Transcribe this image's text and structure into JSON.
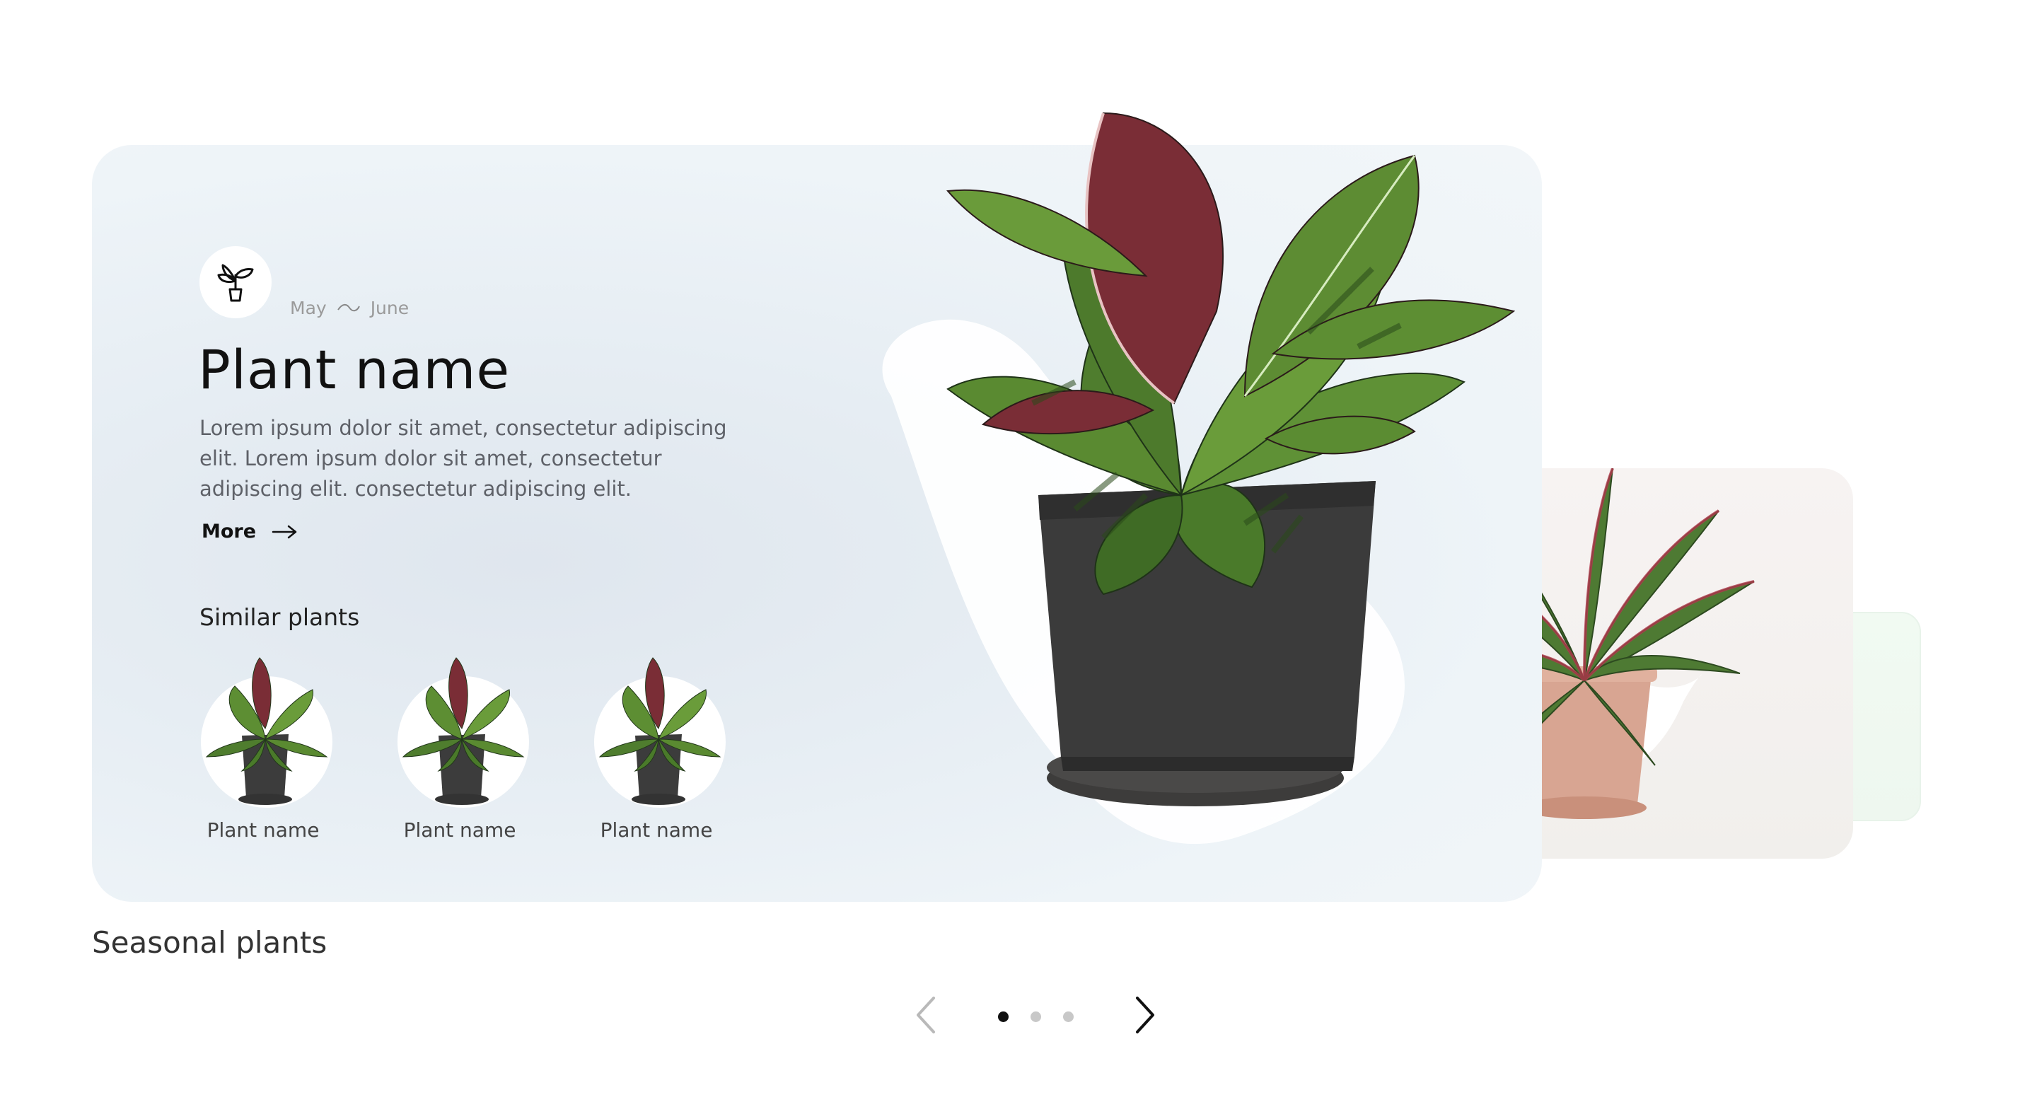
{
  "card": {
    "season_from": "May",
    "season_to": "June",
    "title": "Plant name",
    "description": "Lorem ipsum dolor sit amet, consectetur adipiscing elit. Lorem ipsum dolor sit amet, consectetur adipiscing elit.  consectetur adipiscing elit.",
    "more_label": "More",
    "similar_title": "Similar plants",
    "similar": [
      {
        "label": "Plant name"
      },
      {
        "label": "Plant name"
      },
      {
        "label": "Plant name"
      }
    ]
  },
  "section_title": "Seasonal plants",
  "pager": {
    "dots": 3,
    "active_index": 0,
    "prev_icon": "chevron-left-icon",
    "next_icon": "chevron-right-icon"
  },
  "colors": {
    "card_bg": "#e6edf3",
    "pot_black": "#3a3a3a",
    "pot_terracotta": "#d6a08d",
    "leaf_green": "#5c8a3a",
    "leaf_dark": "#2e4a22",
    "leaf_red": "#7a2e34",
    "dot_active": "#111111",
    "dot_inactive": "#c8c8c8"
  }
}
